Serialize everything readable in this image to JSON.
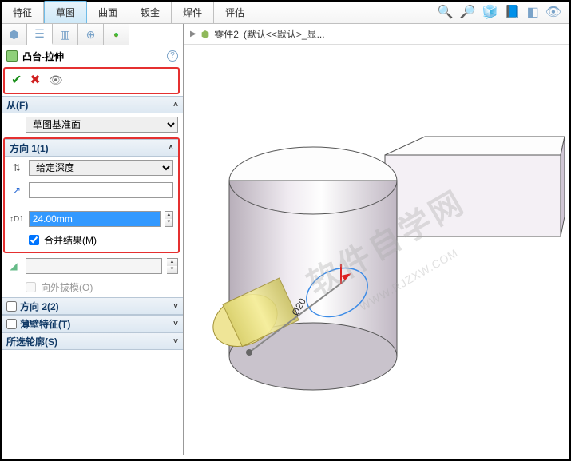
{
  "ribbon": {
    "tabs": [
      "特征",
      "草图",
      "曲面",
      "钣金",
      "焊件",
      "评估"
    ],
    "active_index": 1
  },
  "breadcrumb": {
    "part": "零件2",
    "suffix": "(默认<<默认>_显..."
  },
  "feature": {
    "name": "凸台-拉伸",
    "ok_tip": "确定",
    "cancel_tip": "取消",
    "preview_tip": "预览"
  },
  "from": {
    "title": "从(F)",
    "option": "草图基准面"
  },
  "dir1": {
    "title": "方向 1(1)",
    "end_condition": "给定深度",
    "reverse_tip": "反向",
    "selection": "",
    "depth": "24.00mm",
    "merge_label": "合并结果(M)",
    "merge_checked": true
  },
  "draft": {
    "label": "向外拔模(O)",
    "checked": false
  },
  "dir2": {
    "title": "方向 2(2)",
    "checked": false
  },
  "thin": {
    "title": "薄壁特征(T)",
    "checked": false
  },
  "contour": {
    "title": "所选轮廓(S)"
  },
  "watermark": {
    "text": "软件自学网",
    "url": "WWW.RJZXW.COM"
  },
  "viewport_label": "Ø20"
}
